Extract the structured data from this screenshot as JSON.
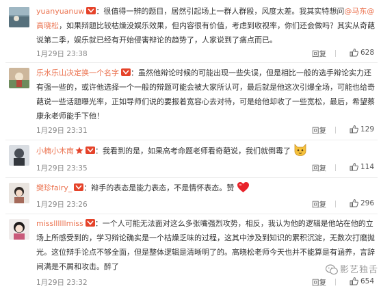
{
  "comments": [
    {
      "username": "yuanyuanuw",
      "text_before": "：很值得一辨的题目，居然引起场上一群人群殴，风度太差。我其实特想问",
      "mention_1": "@马东",
      "mention_2": "@高晓松",
      "text_after": "，如果辩题比较枯燥没娱乐效果，但内容很有价值，考虑到收视率，你们还会做吗？其实从奇葩说第二季，娱乐就已经有开始侵害辩论的趋势了，人家说到了痛点而已。",
      "time": "1月29日 23:38",
      "reply_label": "回复",
      "likes": "628"
    },
    {
      "username": "乐水乐山决定换一个名字",
      "text": "：虽然他辩论时候的可能出现一些失误，但是相比一般的选手辩论实力还有强一些的，或许他选择一个一般的辩题可能会被大家所认可，最后就是他这次引爆全场，可能也给奇葩说一些话题曝光率，正如导师们说的要报着宽容心去对待，可是给他却收了一些宽松，最后，希望蔡康永老师能手下他！",
      "time": "1月29日 23:31",
      "reply_label": "回复",
      "likes": "129"
    },
    {
      "username": "小楠小木南",
      "text": "：我看到的是，如果高考命题老师看奇葩说，我们就倒霉了",
      "time": "1月29日 23:35",
      "reply_label": "回复",
      "likes": "114"
    },
    {
      "username": "樊珍fairy_",
      "text": "：辩手的表态是能力表态，不是情怀表态。赞",
      "time": "1月29日 23:26",
      "reply_label": "回复",
      "likes": "296"
    },
    {
      "username": "missllllllmiss",
      "text": "：一个人可能无法面对这么多张嘴强烈攻势，相反，我认为他的逻辑是他站在他的立场上所感受到的，学习辩论确实是一个枯燥乏味的过程，这其中涉及到知识的累积沉淀，无数次打磨抛光。这位辩手论点不够全面，但是整体逻辑是清晰明了的。高晓松老师今天也并不能算是有涵养，言辞间满是不屑和攻击。醉了",
      "time": "1月29日 23:32",
      "reply_label": "回复",
      "likes": "654"
    }
  ],
  "watermark": "影艺独舌",
  "colors": {
    "username": "#eb7350",
    "vip_badge": "#e5432a",
    "meta_text": "#888888",
    "heart": "#e8232a",
    "emoji_face": "#f6c23c"
  },
  "icons": [
    "vip-badge-icon",
    "star-icon",
    "cat-face-emoji",
    "heart-emoji",
    "thumbs-up-icon",
    "wechat-icon"
  ]
}
